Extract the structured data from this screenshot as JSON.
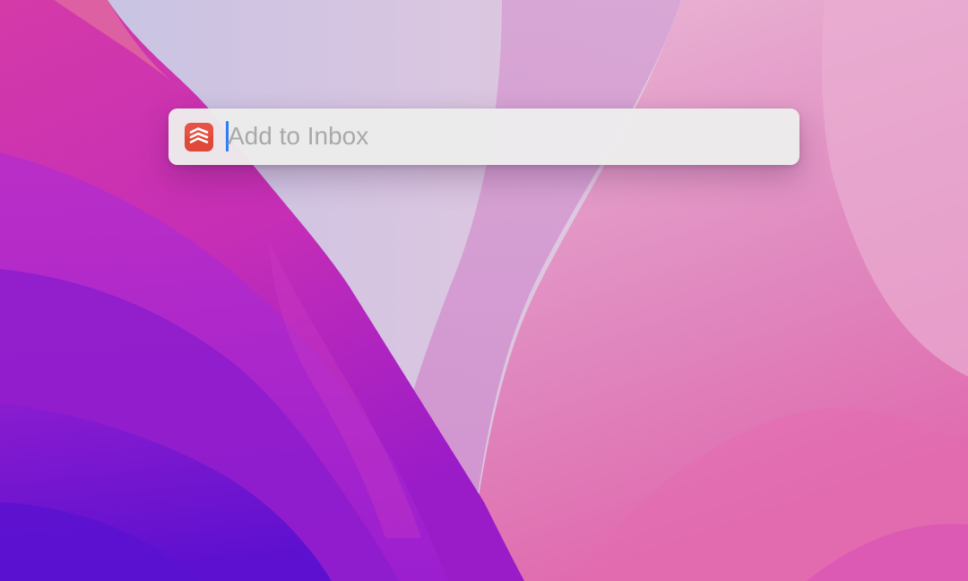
{
  "quick_add": {
    "placeholder": "Add to Inbox",
    "value": "",
    "app_icon": "todoist-icon",
    "accent_color": "#2f7cf6",
    "icon_color": "#e0483a"
  },
  "wallpaper": {
    "colors": [
      "#c92fb0",
      "#6a14cf",
      "#d89fd0",
      "#e87ab8",
      "#c7c8e6"
    ]
  }
}
